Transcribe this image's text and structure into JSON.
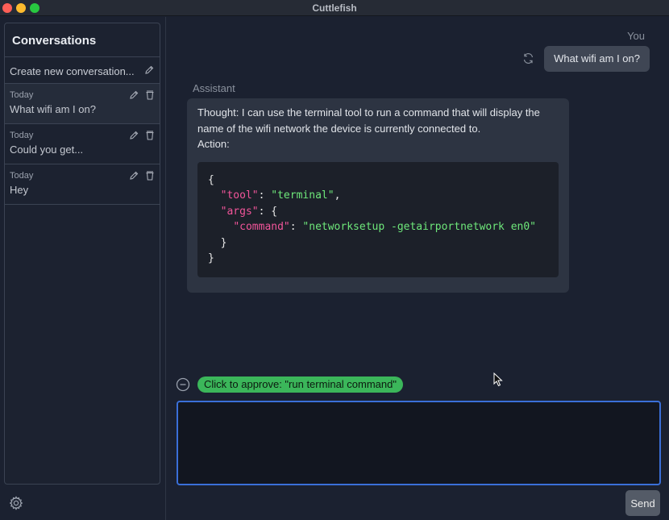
{
  "window": {
    "title": "Cuttlefish"
  },
  "sidebar": {
    "header": "Conversations",
    "new_conversation_label": "Create new conversation...",
    "conversations": [
      {
        "date": "Today",
        "title": "What wifi am I on?"
      },
      {
        "date": "Today",
        "title": "Could you get..."
      },
      {
        "date": "Today",
        "title": "Hey"
      }
    ]
  },
  "chat": {
    "user_label": "You",
    "user_message": "What wifi am I on?",
    "assistant_label": "Assistant",
    "thought_line1": "Thought: I can use the terminal tool to run a command that will display the",
    "thought_line2": "name of the wifi network the device is currently connected to.",
    "action_label": "Action:",
    "code": {
      "tool_key": "\"tool\"",
      "tool_value": "\"terminal\"",
      "args_key": "\"args\"",
      "command_key": "\"command\"",
      "command_value": "\"networksetup -getairportnetwork en0\""
    }
  },
  "approval": {
    "label": "Click to approve: \"run terminal command\""
  },
  "composer": {
    "value": "",
    "send_label": "Send"
  },
  "colors": {
    "accent": "#3a6fd8",
    "approve": "#3bb65a",
    "json_key": "#f2559a",
    "json_string": "#6ee77a"
  },
  "icons": [
    "pencil-icon",
    "trash-icon",
    "gear-icon",
    "refresh-icon",
    "minus-circle-icon",
    "cursor-icon"
  ]
}
